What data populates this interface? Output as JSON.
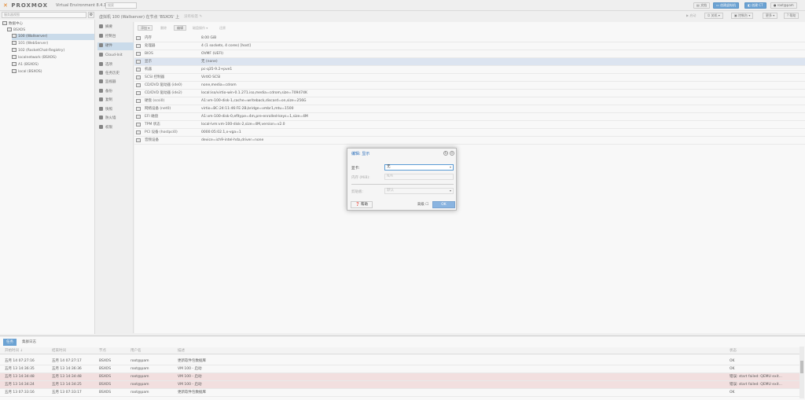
{
  "topbar": {
    "logo": "PROXMOX",
    "version": "Virtual Environment 8.4.1",
    "search_placeholder": "搜索",
    "btn_docs": "文档",
    "btn_create_vm": "创建虚拟机",
    "btn_create_ct": "创建 CT",
    "btn_user": "root@pam"
  },
  "view_selector": "服务器视图",
  "tree": {
    "items": [
      {
        "label": "数据中心"
      },
      {
        "label": "BSXOS"
      },
      {
        "label": "100 (Wallserver)"
      },
      {
        "label": "101 (WebServer)"
      },
      {
        "label": "102 (RocketChat-Registry)"
      },
      {
        "label": "localnetwork (BSXOS)"
      },
      {
        "label": "A1 (BSXOS)"
      },
      {
        "label": "local (BSXOS)"
      }
    ]
  },
  "header": {
    "title": "虚拟机 100 (Wallserver) 在节点 'BSXOS' 上",
    "tags": "没有标签",
    "btn_start": "启动",
    "btn_shutdown": "关机",
    "btn_console": "控制台",
    "btn_more": "更多",
    "btn_help": "帮助"
  },
  "nav": {
    "items": [
      {
        "label": "摘要"
      },
      {
        "label": "控制台"
      },
      {
        "label": "硬件"
      },
      {
        "label": "Cloud-Init"
      },
      {
        "label": "选项"
      },
      {
        "label": "任务历史"
      },
      {
        "label": "监视器"
      },
      {
        "label": "备份"
      },
      {
        "label": "复制"
      },
      {
        "label": "快照"
      },
      {
        "label": "防火墙"
      },
      {
        "label": "权限"
      }
    ]
  },
  "hw_toolbar": {
    "add": "添加",
    "remove": "删除",
    "edit": "编辑",
    "disk_action": "磁盘操作",
    "revert": "还原"
  },
  "hardware": [
    {
      "key": "内存",
      "value": "8.00 GiB"
    },
    {
      "key": "处理器",
      "value": "4 (1 sockets, 4 cores) [host]"
    },
    {
      "key": "BIOS",
      "value": "OVMF (UEFI)"
    },
    {
      "key": "显示",
      "value": "无 (none)"
    },
    {
      "key": "机器",
      "value": "pc-q35-9.2+pve1"
    },
    {
      "key": "SCSI 控制器",
      "value": "VirtIO SCSI"
    },
    {
      "key": "CD/DVD 驱动器 (ide0)",
      "value": "none,media=cdrom"
    },
    {
      "key": "CD/DVD 驱动器 (ide2)",
      "value": "local:iso/virtio-win-0.1.271.iso,media=cdrom,size=709474K"
    },
    {
      "key": "硬盘 (scsi0)",
      "value": "A1:vm-100-disk-1,cache=writeback,discard=on,size=256G"
    },
    {
      "key": "网络设备 (net0)",
      "value": "virtio=BC:24:11:46:FE:2B,bridge=vmbr1,mtu=1500"
    },
    {
      "key": "EFI 磁盘",
      "value": "A1:vm-100-disk-0,efitype=4m,pre-enrolled-keys=1,size=4M"
    },
    {
      "key": "TPM 状态",
      "value": "local-lvm:vm-100-disk-2,size=4M,version=v2.0"
    },
    {
      "key": "PCI 设备 (hostpci0)",
      "value": "0000:05:02.1,x-vga=1"
    },
    {
      "key": "音频设备",
      "value": "device=ich9-intel-hda,driver=none"
    }
  ],
  "dialog": {
    "title": "编辑: 显示",
    "label_display": "显卡:",
    "value_display": "无",
    "label_memory": "内存 (MiB):",
    "value_memory": "N/A",
    "label_clipboard": "剪贴板:",
    "value_clipboard": "默认",
    "btn_help": "帮助",
    "btn_advanced": "高级",
    "btn_ok": "OK"
  },
  "tasks": {
    "tab_tasks": "任务",
    "tab_cluster": "集群日志",
    "headers": [
      "开始时间 ↓",
      "结束时间",
      "节点",
      "用户名",
      "描述",
      "状态"
    ],
    "rows": [
      {
        "start": "五月 14 07:27:16",
        "end": "五月 14 07:27:17",
        "node": "BSXOS",
        "user": "root@pam",
        "desc": "更新软件包数据库",
        "status": "OK",
        "err": false
      },
      {
        "start": "五月 13 14:36:35",
        "end": "五月 13 14:36:36",
        "node": "BSXOS",
        "user": "root@pam",
        "desc": "VM 100 - 启动",
        "status": "OK",
        "err": false
      },
      {
        "start": "五月 13 14:34:48",
        "end": "五月 13 14:34:48",
        "node": "BSXOS",
        "user": "root@pam",
        "desc": "VM 100 - 启动",
        "status": "错误: start failed: QEMU exit...",
        "err": true
      },
      {
        "start": "五月 13 14:34:24",
        "end": "五月 13 14:34:25",
        "node": "BSXOS",
        "user": "root@pam",
        "desc": "VM 100 - 启动",
        "status": "错误: start failed: QEMU exit...",
        "err": true
      },
      {
        "start": "五月 13 07:33:16",
        "end": "五月 13 07:33:17",
        "node": "BSXOS",
        "user": "root@pam",
        "desc": "更新软件包数据库",
        "status": "OK",
        "err": false
      }
    ]
  }
}
